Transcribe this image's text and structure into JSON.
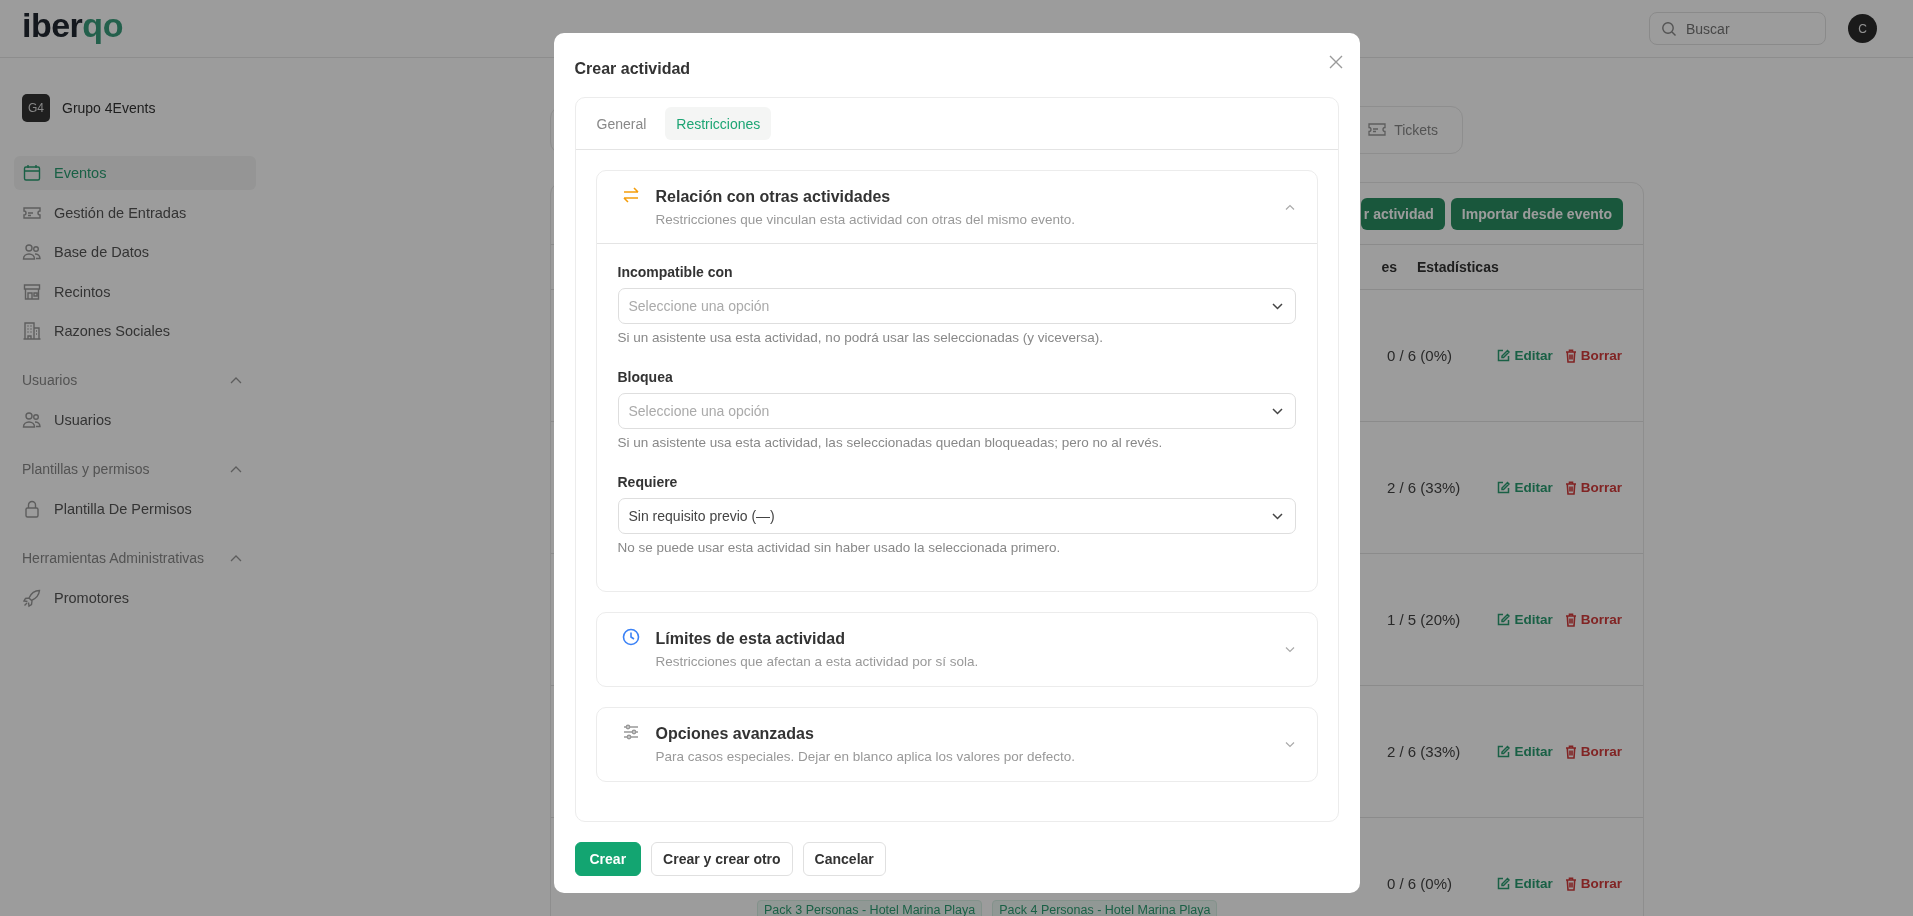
{
  "header": {
    "logo": {
      "dark": "iber",
      "accent": "qo"
    },
    "search": {
      "placeholder": "Buscar"
    },
    "avatar": "C"
  },
  "org": {
    "badge": "G4",
    "name": "Grupo 4Events"
  },
  "sidebar": {
    "items": [
      {
        "label": "Eventos",
        "selected": true
      },
      {
        "label": "Gestión de Entradas",
        "selected": false
      },
      {
        "label": "Base de Datos",
        "selected": false
      },
      {
        "label": "Recintos",
        "selected": false
      },
      {
        "label": "Razones Sociales",
        "selected": false
      }
    ],
    "groups": [
      {
        "title": "Usuarios",
        "expanded": true,
        "items": [
          {
            "label": "Usuarios",
            "selected": false
          }
        ]
      },
      {
        "title": "Plantillas y permisos",
        "expanded": true,
        "items": [
          {
            "label": "Plantilla De Permisos",
            "selected": false
          }
        ]
      },
      {
        "title": "Herramientas Administrativas",
        "expanded": true,
        "items": [
          {
            "label": "Promotores",
            "selected": false
          }
        ]
      }
    ]
  },
  "page_tabs": [
    {
      "label": "Tickets",
      "selected": false
    }
  ],
  "toolbar": {
    "buttons": [
      "r actividad",
      "Importar desde evento"
    ]
  },
  "table": {
    "columns": [
      "es",
      "Estadísticas"
    ],
    "rows": [
      {
        "stats": "0 / 6 (0%)",
        "edit": "Editar",
        "delete": "Borrar"
      },
      {
        "stats": "2 / 6 (33%)",
        "edit": "Editar",
        "delete": "Borrar"
      },
      {
        "stats": "1 / 5 (20%)",
        "edit": "Editar",
        "delete": "Borrar"
      },
      {
        "stats": "2 / 6 (33%)",
        "edit": "Editar",
        "delete": "Borrar"
      },
      {
        "stats": "0 / 6 (0%)",
        "edit": "Editar",
        "delete": "Borrar",
        "tags": [
          "Pack 3 Personas - Hotel Marina Playa",
          "Pack 4 Personas - Hotel Marina Playa"
        ]
      }
    ]
  },
  "dialog": {
    "title": "Crear actividad",
    "tabs": [
      {
        "label": "General",
        "selected": false
      },
      {
        "label": "Restricciones",
        "selected": true
      }
    ],
    "sections": [
      {
        "title": "Relación con otras actividades",
        "subtitle": "Restricciones que vinculan esta actividad con otras del mismo evento.",
        "expanded": true,
        "fields": [
          {
            "label": "Incompatible con",
            "placeholder": "Seleccione una opción",
            "help": "Si un asistente usa esta actividad, no podrá usar las seleccionadas (y viceversa)."
          },
          {
            "label": "Bloquea",
            "placeholder": "Seleccione una opción",
            "help": "Si un asistente usa esta actividad, las seleccionadas quedan bloqueadas; pero no al revés."
          },
          {
            "label": "Requiere",
            "value": "Sin requisito previo (—)",
            "help": "No se puede usar esta actividad sin haber usado la seleccionada primero."
          }
        ]
      },
      {
        "title": "Límites de esta actividad",
        "subtitle": "Restricciones que afectan a esta actividad por sí sola.",
        "expanded": false
      },
      {
        "title": "Opciones avanzadas",
        "subtitle": "Para casos especiales. Dejar en blanco aplica los valores por defecto.",
        "expanded": false
      }
    ],
    "buttons": [
      {
        "label": "Crear",
        "primary": true
      },
      {
        "label": "Crear y crear otro",
        "primary": false
      },
      {
        "label": "Cancelar",
        "primary": false
      }
    ]
  }
}
